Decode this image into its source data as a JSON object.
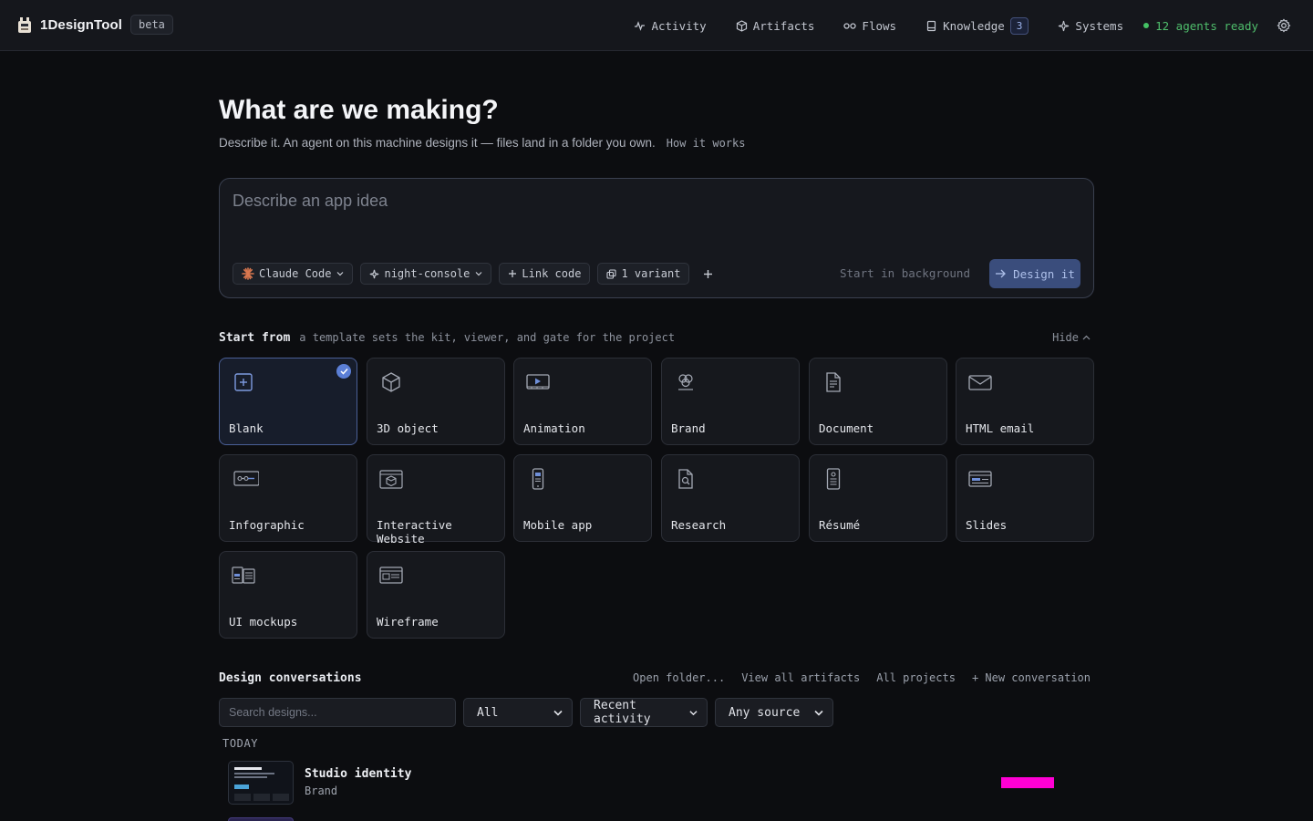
{
  "app": {
    "name": "1DesignTool",
    "badge": "beta"
  },
  "nav": {
    "items": [
      {
        "label": "Activity",
        "icon": "activity-icon"
      },
      {
        "label": "Artifacts",
        "icon": "cube-icon"
      },
      {
        "label": "Flows",
        "icon": "infinity-icon"
      },
      {
        "label": "Knowledge",
        "icon": "book-icon",
        "count": "3"
      },
      {
        "label": "Systems",
        "icon": "sparkle-icon"
      }
    ],
    "status": "12 agents ready",
    "status_color": "#44c264"
  },
  "hero": {
    "title": "What are we making?",
    "subtitle": "Describe it. An agent on this machine designs it — files land in a folder you own.",
    "how_link": "How it works"
  },
  "prompt": {
    "placeholder": "Describe an app idea",
    "value": "",
    "chips": {
      "agent": "Claude Code",
      "theme": "night-console",
      "link": "Link code",
      "variants": "1 variant"
    },
    "background_label": "Start in background",
    "submit_label": "Design it"
  },
  "templates": {
    "title": "Start from",
    "description": "a template sets the kit, viewer, and gate for the project",
    "hide_label": "Hide",
    "selected": "Blank",
    "items": [
      {
        "label": "Blank",
        "icon": "plus-square-icon"
      },
      {
        "label": "3D object",
        "icon": "cube-icon"
      },
      {
        "label": "Animation",
        "icon": "play-film-icon"
      },
      {
        "label": "Brand",
        "icon": "brand-circles-icon"
      },
      {
        "label": "Document",
        "icon": "document-icon"
      },
      {
        "label": "HTML email",
        "icon": "envelope-icon"
      },
      {
        "label": "Infographic",
        "icon": "infographic-icon"
      },
      {
        "label": "Interactive Website",
        "icon": "website-cube-icon"
      },
      {
        "label": "Mobile app",
        "icon": "phone-icon"
      },
      {
        "label": "Research",
        "icon": "research-doc-icon"
      },
      {
        "label": "Résumé",
        "icon": "resume-icon"
      },
      {
        "label": "Slides",
        "icon": "slides-icon"
      },
      {
        "label": "UI mockups",
        "icon": "ui-mockups-icon"
      },
      {
        "label": "Wireframe",
        "icon": "wireframe-icon"
      }
    ]
  },
  "conversations": {
    "title": "Design conversations",
    "links": [
      "Open folder...",
      "View all artifacts",
      "All projects",
      "+ New conversation"
    ],
    "search_placeholder": "Search designs...",
    "filters": {
      "scope": "All",
      "sort": "Recent activity",
      "source": "Any source"
    },
    "groups": [
      {
        "label": "TODAY",
        "items": [
          {
            "title": "Studio identity",
            "type": "Brand",
            "marker_color": "#ff00d4"
          }
        ]
      }
    ]
  }
}
